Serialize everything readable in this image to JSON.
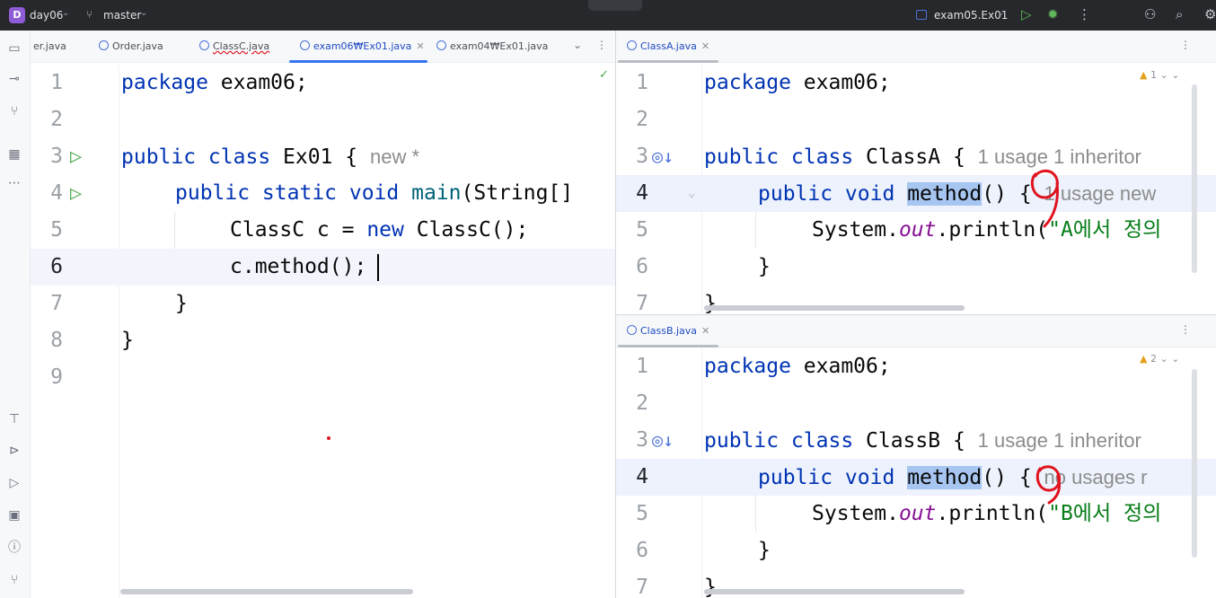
{
  "titlebar": {
    "project_badge": "D",
    "project_name": "day06",
    "branch": "master",
    "run_config": "exam05.Ex01"
  },
  "icons": {
    "chevron": "⌄",
    "branch": "⑂",
    "run": "▷",
    "debug": "✹",
    "more": "⋮",
    "add_user": "⚇",
    "search": "⌕",
    "settings": "⚙",
    "close": "✕",
    "check": "✓",
    "warning": "▲"
  },
  "left_pane": {
    "tabs": [
      {
        "label": "er.java"
      },
      {
        "label": "Order.java"
      },
      {
        "label": "ClassC.java"
      },
      {
        "label": "exam06₩Ex01.java"
      },
      {
        "label": "exam04₩Ex01.java"
      }
    ],
    "hint_new": "new *",
    "lines": [
      {
        "n": "1"
      },
      {
        "n": "2"
      },
      {
        "n": "3"
      },
      {
        "n": "4"
      },
      {
        "n": "5"
      },
      {
        "n": "6"
      },
      {
        "n": "7"
      },
      {
        "n": "8"
      },
      {
        "n": "9"
      }
    ],
    "code": {
      "l1_kw": "package",
      "l1_rest": " exam06;",
      "l3_kw": "public class",
      "l3_rest": " Ex01 {",
      "l4_kw": "public static void",
      "l4_fn": "main",
      "l4_rest": "(String[]",
      "l5_a": "ClassC c = ",
      "l5_kw": "new",
      "l5_b": " ClassC();",
      "l6": "c.method();",
      "l7": "}",
      "l8": "}"
    }
  },
  "top_right_pane": {
    "tab": "ClassA.java",
    "warnings": "1",
    "lines": [
      {
        "n": "1"
      },
      {
        "n": "2"
      },
      {
        "n": "3"
      },
      {
        "n": "4"
      },
      {
        "n": "5"
      },
      {
        "n": "6"
      },
      {
        "n": "7"
      }
    ],
    "code": {
      "l1_kw": "package",
      "l1_rest": " exam06;",
      "l3_kw": "public class",
      "l3_rest": " ClassA {",
      "l3_hint": "1 usage   1 inheritor",
      "l4_kw": "public void",
      "l4_sel": "method",
      "l4_rest": "() {",
      "l4_hint": "1 usage   new",
      "l5_a": "System.",
      "l5_fld": "out",
      "l5_b": ".println(",
      "l5_str": "\"A에서 정의",
      "l6": "}",
      "l7": "}"
    }
  },
  "bottom_right_pane": {
    "tab": "ClassB.java",
    "warnings": "2",
    "lines": [
      {
        "n": "1"
      },
      {
        "n": "2"
      },
      {
        "n": "3"
      },
      {
        "n": "4"
      },
      {
        "n": "5"
      },
      {
        "n": "6"
      },
      {
        "n": "7"
      }
    ],
    "code": {
      "l1_kw": "package",
      "l1_rest": " exam06;",
      "l3_kw": "public class",
      "l3_rest": " ClassB {",
      "l3_hint": "1 usage   1 inheritor",
      "l4_kw": "public void",
      "l4_sel": "method",
      "l4_rest": "() {",
      "l4_hint": "no usages   r",
      "l5_a": "System.",
      "l5_fld": "out",
      "l5_b": ".println(",
      "l5_str": "\"B에서 정의",
      "l6": "}",
      "l7": "}"
    }
  },
  "colors": {
    "keyword": "#0033b3",
    "string": "#067d17",
    "field": "#871094",
    "accent": "#3574f0",
    "annotation": "#e0141e"
  }
}
